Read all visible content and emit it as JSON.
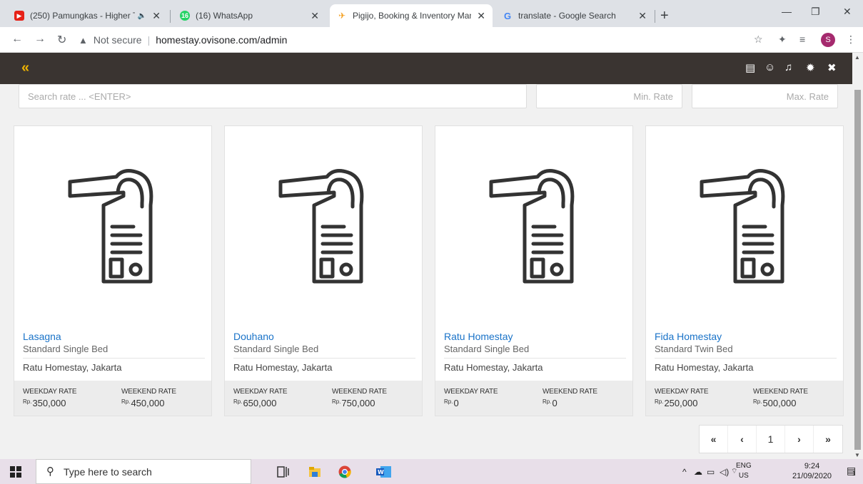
{
  "browser": {
    "tabs": [
      {
        "title": "(250) Pamungkas - Higher Th",
        "badge": "▶",
        "color": "#e62117",
        "audio": "🔈"
      },
      {
        "title": "(16) WhatsApp",
        "badge": "16",
        "color": "#25d366"
      },
      {
        "title": "Pigijo, Booking & Inventory Man",
        "badge": "✈",
        "color": "#f4a020"
      },
      {
        "title": "translate - Google Search",
        "badge": "G",
        "color": "#4285f4"
      }
    ],
    "url_warning": "Not secure",
    "url": "homestay.ovisone.com/admin"
  },
  "search": {
    "rate_placeholder": "Search rate ... <ENTER>",
    "min_placeholder": "Min. Rate",
    "max_placeholder": "Max. Rate"
  },
  "labels": {
    "weekday": "WEEKDAY RATE",
    "weekend": "WEEKEND RATE",
    "currency": "Rp."
  },
  "rooms": [
    {
      "name": "Lasagna",
      "type": "Standard Single Bed",
      "location": "Ratu Homestay, Jakarta",
      "weekday": "350,000",
      "weekend": "450,000"
    },
    {
      "name": "Douhano",
      "type": "Standard Single Bed",
      "location": "Ratu Homestay, Jakarta",
      "weekday": "650,000",
      "weekend": "750,000"
    },
    {
      "name": "Ratu Homestay",
      "type": "Standard Single Bed",
      "location": "Ratu Homestay, Jakarta",
      "weekday": "0",
      "weekend": "0"
    },
    {
      "name": "Fida Homestay",
      "type": "Standard Twin Bed",
      "location": "Ratu Homestay, Jakarta",
      "weekday": "250,000",
      "weekend": "500,000"
    }
  ],
  "pagination": {
    "first": "«",
    "prev": "‹",
    "current": "1",
    "next": "›",
    "last": "»"
  },
  "taskbar": {
    "search_placeholder": "Type here to search",
    "lang_top": "ENG",
    "lang_bottom": "US",
    "time": "9:24",
    "date": "21/09/2020",
    "notifications": "1"
  }
}
